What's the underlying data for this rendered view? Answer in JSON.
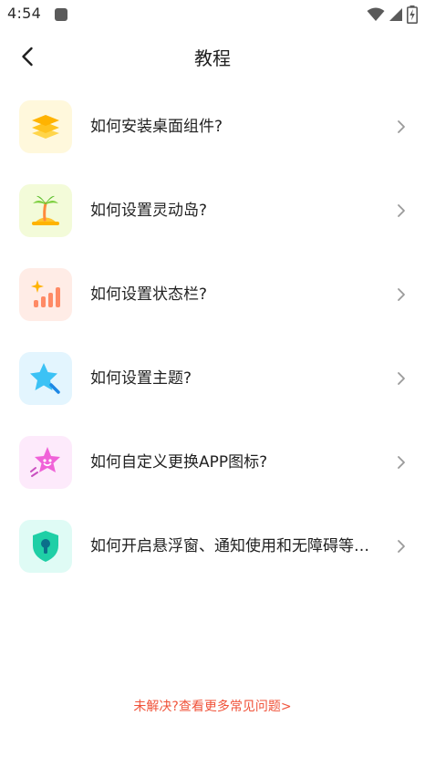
{
  "status_bar": {
    "time": "4:54",
    "icons": [
      "notification-icon",
      "wifi-icon",
      "signal-icon",
      "battery-charging-icon"
    ]
  },
  "header": {
    "back_icon": "chevron-left-icon",
    "title": "教程"
  },
  "tutorials": [
    {
      "label": "如何安装桌面组件?",
      "icon": "layers-icon",
      "bg": "#fff8dc"
    },
    {
      "label": "如何设置灵动岛?",
      "icon": "palm-island-icon",
      "bg": "#f3fbd9"
    },
    {
      "label": "如何设置状态栏?",
      "icon": "signal-bars-sparkle-icon",
      "bg": "#ffece6"
    },
    {
      "label": "如何设置主题?",
      "icon": "star-wand-icon",
      "bg": "#e3f5fe"
    },
    {
      "label": "如何自定义更换APP图标?",
      "icon": "smiling-star-icon",
      "bg": "#fdeafb"
    },
    {
      "label": "如何开启悬浮窗、通知使用和无障碍等权限?",
      "icon": "shield-keyhole-icon",
      "bg": "#dffbf5"
    }
  ],
  "footer": {
    "help_link": "未解决?查看更多常见问题>"
  },
  "colors": {
    "accent_link": "#f0533a",
    "arrow": "#9a9a9a",
    "text": "#222222"
  }
}
